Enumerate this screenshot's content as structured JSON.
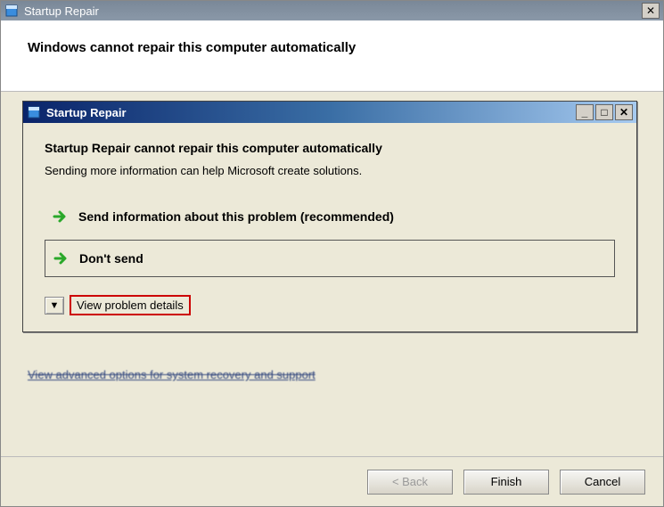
{
  "outer": {
    "title": "Startup Repair",
    "heading": "Windows cannot repair this computer automatically",
    "hidden_link": "View advanced options for system recovery and support"
  },
  "inner": {
    "title": "Startup Repair",
    "heading": "Startup Repair cannot repair this computer automatically",
    "subtext": "Sending more information can help Microsoft create solutions.",
    "option_send": "Send information about this problem (recommended)",
    "option_dont": "Don't send",
    "details_label": "View problem details"
  },
  "footer": {
    "back": "< Back",
    "finish": "Finish",
    "cancel": "Cancel"
  },
  "icons": {
    "close_glyph": "✕",
    "minimize_glyph": "_",
    "maximize_glyph": "□",
    "expand_glyph": "▼"
  }
}
